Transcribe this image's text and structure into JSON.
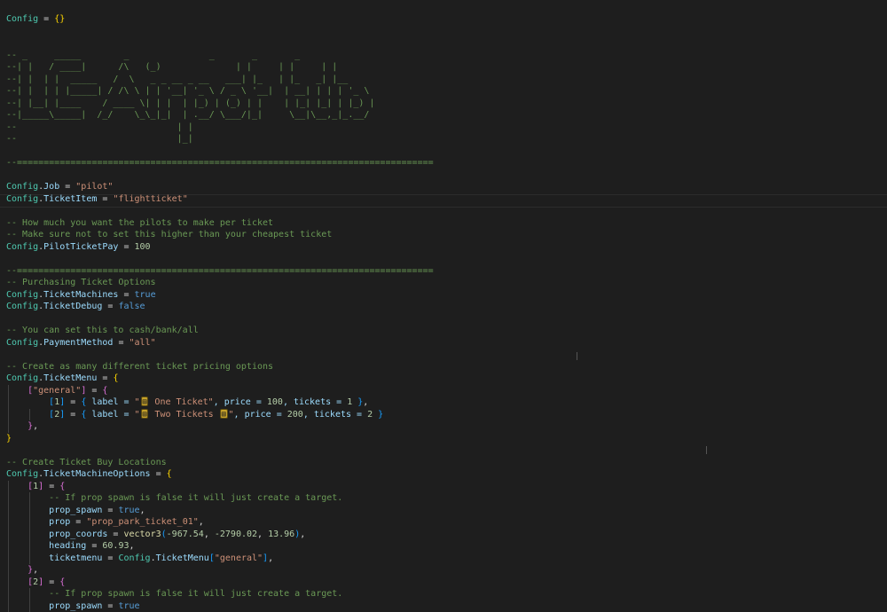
{
  "editor": {
    "language": "lua",
    "lines": [
      [
        [
          "Config",
          "var"
        ],
        [
          " = ",
          "op"
        ],
        [
          "{}",
          "br1"
        ]
      ],
      [],
      [],
      [
        [
          "-- _     _____        _               _       _       _",
          "cmt"
        ]
      ],
      [
        [
          "--| |   / ____|      /\\   (_)              | |     | |     | |",
          "cmt"
        ]
      ],
      [
        [
          "--| |  | |  _____   /  \\   _ _ __ _ __   ___| |_   | |_   _| |__",
          "cmt"
        ]
      ],
      [
        [
          "--| |  | | |_____| / /\\ \\ | | '__| '_ \\ / _ \\ '__|  | __| | | | '_ \\",
          "cmt"
        ]
      ],
      [
        [
          "--| |__| |____    / ____ \\| | |  | |_) | (_) | |    | |_| |_| | |_) |",
          "cmt"
        ]
      ],
      [
        [
          "--|_____\\_____|  /_/    \\_\\_|_|  | .__/ \\___/|_|     \\__|\\__,_|_.__/",
          "cmt"
        ]
      ],
      [
        [
          "--                              | |",
          "cmt"
        ]
      ],
      [
        [
          "--                              |_|",
          "cmt"
        ]
      ],
      [],
      [
        [
          "--==============================================================================",
          "cmt"
        ]
      ],
      [],
      [
        [
          "Config",
          "var"
        ],
        [
          ".",
          "op"
        ],
        [
          "Job",
          "prop"
        ],
        [
          " = ",
          "op"
        ],
        [
          "\"pilot\"",
          "str"
        ]
      ],
      [
        [
          "Config",
          "var"
        ],
        [
          ".",
          "op"
        ],
        [
          "TicketItem",
          "prop"
        ],
        [
          " = ",
          "op"
        ],
        [
          "\"flightticket\"",
          "str"
        ]
      ],
      [],
      [
        [
          "-- How much you want the pilots to make per ticket",
          "cmt"
        ]
      ],
      [
        [
          "-- Make sure not to set this higher than your cheapest ticket",
          "cmt"
        ]
      ],
      [
        [
          "Config",
          "var"
        ],
        [
          ".",
          "op"
        ],
        [
          "PilotTicketPay",
          "prop"
        ],
        [
          " = ",
          "op"
        ],
        [
          "100",
          "num"
        ]
      ],
      [],
      [
        [
          "--==============================================================================",
          "cmt"
        ]
      ],
      [
        [
          "-- Purchasing Ticket Options",
          "cmt"
        ]
      ],
      [
        [
          "Config",
          "var"
        ],
        [
          ".",
          "op"
        ],
        [
          "TicketMachines",
          "prop"
        ],
        [
          " = ",
          "op"
        ],
        [
          "true",
          "kw"
        ]
      ],
      [
        [
          "Config",
          "var"
        ],
        [
          ".",
          "op"
        ],
        [
          "TicketDebug",
          "prop"
        ],
        [
          " = ",
          "op"
        ],
        [
          "false",
          "kw"
        ]
      ],
      [],
      [
        [
          "-- You can set this to cash/bank/all",
          "cmt"
        ]
      ],
      [
        [
          "Config",
          "var"
        ],
        [
          ".",
          "op"
        ],
        [
          "PaymentMethod",
          "prop"
        ],
        [
          " = ",
          "op"
        ],
        [
          "\"all\"",
          "str"
        ]
      ],
      [],
      [
        [
          "-- Create as many different ticket pricing options",
          "cmt"
        ]
      ],
      [
        [
          "Config",
          "var"
        ],
        [
          ".",
          "op"
        ],
        [
          "TicketMenu",
          "prop"
        ],
        [
          " = ",
          "op"
        ],
        [
          "{",
          "br1"
        ]
      ],
      [
        [
          "    ",
          "op"
        ],
        [
          "[",
          "br2"
        ],
        [
          "\"general\"",
          "str"
        ],
        [
          "]",
          "br2"
        ],
        [
          " = ",
          "op"
        ],
        [
          "{",
          "br2"
        ]
      ],
      [
        [
          "        ",
          "op"
        ],
        [
          "[",
          "br3"
        ],
        [
          "1",
          "num"
        ],
        [
          "]",
          "br3"
        ],
        [
          " = ",
          "op"
        ],
        [
          "{",
          "br3"
        ],
        [
          " label = ",
          "prop"
        ],
        [
          "\"",
          "str"
        ],
        [
          "▤",
          "emoji"
        ],
        [
          " One Ticket\"",
          "str"
        ],
        [
          ", price = ",
          "prop"
        ],
        [
          "100",
          "num"
        ],
        [
          ", tickets = ",
          "prop"
        ],
        [
          "1",
          "num"
        ],
        [
          " ",
          "op"
        ],
        [
          "}",
          "br3"
        ],
        [
          ",",
          "op"
        ]
      ],
      [
        [
          "        ",
          "op"
        ],
        [
          "[",
          "br3"
        ],
        [
          "2",
          "num"
        ],
        [
          "]",
          "br3"
        ],
        [
          " = ",
          "op"
        ],
        [
          "{",
          "br3"
        ],
        [
          " label = ",
          "prop"
        ],
        [
          "\"",
          "str"
        ],
        [
          "▤",
          "emoji"
        ],
        [
          " Two Tickets ",
          "str"
        ],
        [
          "▤",
          "emoji"
        ],
        [
          "\"",
          "str"
        ],
        [
          ", price = ",
          "prop"
        ],
        [
          "200",
          "num"
        ],
        [
          ", tickets = ",
          "prop"
        ],
        [
          "2",
          "num"
        ],
        [
          " ",
          "op"
        ],
        [
          "}",
          "br3"
        ]
      ],
      [
        [
          "    ",
          "op"
        ],
        [
          "}",
          "br2"
        ],
        [
          ",",
          "op"
        ]
      ],
      [
        [
          "}",
          "br1"
        ]
      ],
      [],
      [
        [
          "-- Create Ticket Buy Locations",
          "cmt"
        ]
      ],
      [
        [
          "Config",
          "var"
        ],
        [
          ".",
          "op"
        ],
        [
          "TicketMachineOptions",
          "prop"
        ],
        [
          " = ",
          "op"
        ],
        [
          "{",
          "br1"
        ]
      ],
      [
        [
          "    ",
          "op"
        ],
        [
          "[",
          "br2"
        ],
        [
          "1",
          "num"
        ],
        [
          "]",
          "br2"
        ],
        [
          " = ",
          "op"
        ],
        [
          "{",
          "br2"
        ]
      ],
      [
        [
          "        ",
          "op"
        ],
        [
          "-- If prop spawn is false it will just create a target.",
          "cmt"
        ]
      ],
      [
        [
          "        ",
          "op"
        ],
        [
          "prop_spawn",
          "prop"
        ],
        [
          " = ",
          "op"
        ],
        [
          "true",
          "kw"
        ],
        [
          ",",
          "op"
        ]
      ],
      [
        [
          "        ",
          "op"
        ],
        [
          "prop",
          "prop"
        ],
        [
          " = ",
          "op"
        ],
        [
          "\"prop_park_ticket_01\"",
          "str"
        ],
        [
          ",",
          "op"
        ]
      ],
      [
        [
          "        ",
          "op"
        ],
        [
          "prop_coords",
          "prop"
        ],
        [
          " = ",
          "op"
        ],
        [
          "vector3",
          "fn"
        ],
        [
          "(",
          "br3"
        ],
        [
          "-967.54",
          "num"
        ],
        [
          ", ",
          "op"
        ],
        [
          "-2790.02",
          "num"
        ],
        [
          ", ",
          "op"
        ],
        [
          "13.96",
          "num"
        ],
        [
          ")",
          "br3"
        ],
        [
          ",",
          "op"
        ]
      ],
      [
        [
          "        ",
          "op"
        ],
        [
          "heading",
          "prop"
        ],
        [
          " = ",
          "op"
        ],
        [
          "60.93",
          "num"
        ],
        [
          ",",
          "op"
        ]
      ],
      [
        [
          "        ",
          "op"
        ],
        [
          "ticketmenu",
          "prop"
        ],
        [
          " = ",
          "op"
        ],
        [
          "Config",
          "var"
        ],
        [
          ".",
          "op"
        ],
        [
          "TicketMenu",
          "prop"
        ],
        [
          "[",
          "br3"
        ],
        [
          "\"general\"",
          "str"
        ],
        [
          "]",
          "br3"
        ],
        [
          ",",
          "op"
        ]
      ],
      [
        [
          "    ",
          "op"
        ],
        [
          "}",
          "br2"
        ],
        [
          ",",
          "op"
        ]
      ],
      [
        [
          "    ",
          "op"
        ],
        [
          "[",
          "br2"
        ],
        [
          "2",
          "num"
        ],
        [
          "]",
          "br2"
        ],
        [
          " = ",
          "op"
        ],
        [
          "{",
          "br2"
        ]
      ],
      [
        [
          "        ",
          "op"
        ],
        [
          "-- If prop spawn is false it will just create a target.",
          "cmt"
        ]
      ],
      [
        [
          "        ",
          "op"
        ],
        [
          "prop_spawn",
          "prop"
        ],
        [
          " = ",
          "op"
        ],
        [
          "true",
          "kw"
        ]
      ]
    ]
  }
}
